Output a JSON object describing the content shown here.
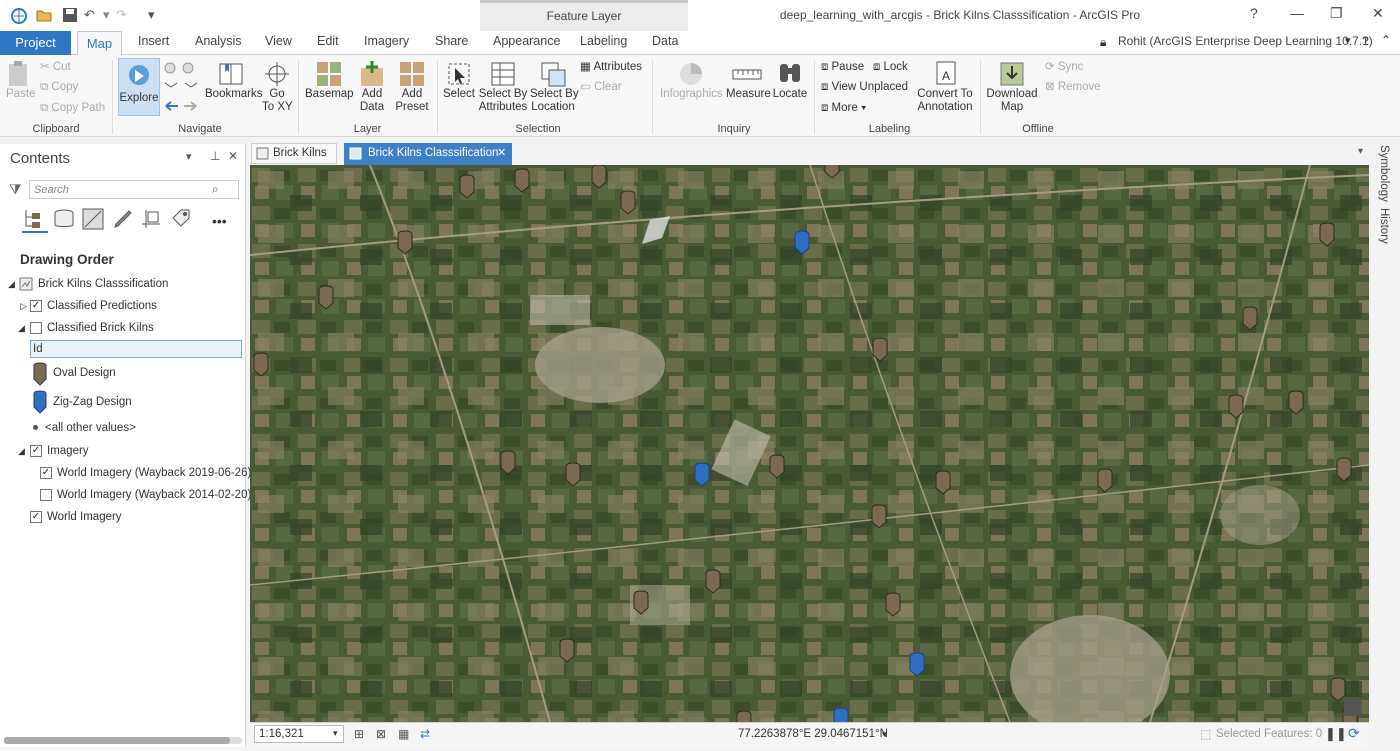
{
  "window": {
    "title": "deep_learning_with_arcgis - Brick Kilns Classsification - ArcGIS Pro",
    "context_tab": "Feature Layer"
  },
  "tabs": [
    "Project",
    "Map",
    "Insert",
    "Analysis",
    "View",
    "Edit",
    "Imagery",
    "Share",
    "Appearance",
    "Labeling",
    "Data"
  ],
  "user": "Rohit (ArcGIS Enterprise Deep Learning 10.7.1)",
  "clipboard": {
    "paste": "Paste",
    "cut": "Cut",
    "copy": "Copy",
    "copy_path": "Copy Path",
    "group": "Clipboard"
  },
  "navigate": {
    "explore": "Explore",
    "bookmarks": "Bookmarks",
    "go_to_xy": "Go\nTo XY",
    "group": "Navigate"
  },
  "layer": {
    "basemap": "Basemap",
    "add_data": "Add\nData",
    "add_preset": "Add\nPreset",
    "group": "Layer"
  },
  "selection": {
    "select": "Select",
    "select_by_attributes": "Select By\nAttributes",
    "select_by_location": "Select By\nLocation",
    "attributes": "Attributes",
    "clear": "Clear",
    "group": "Selection"
  },
  "inquiry": {
    "infographics": "Infographics",
    "measure": "Measure",
    "locate": "Locate",
    "group": "Inquiry"
  },
  "labeling": {
    "pause": "Pause",
    "lock": "Lock",
    "view_unplaced": "View Unplaced",
    "more": "More",
    "convert_to_annotation": "Convert To\nAnnotation",
    "group": "Labeling"
  },
  "offline": {
    "download_map": "Download\nMap",
    "sync": "Sync",
    "remove": "Remove",
    "group": "Offline"
  },
  "contents": {
    "title": "Contents",
    "search_placeholder": "Search",
    "section": "Drawing Order",
    "map": "Brick Kilns Classsification",
    "layers": [
      {
        "label": "Classified Predictions",
        "checked": true
      },
      {
        "label": "Classified Brick Kilns",
        "checked": false
      },
      {
        "label": "Id"
      },
      {
        "label": "Oval Design"
      },
      {
        "label": "Zig-Zag Design"
      },
      {
        "label": "<all other values>"
      },
      {
        "label": "Imagery",
        "checked": true
      },
      {
        "label": "World Imagery (Wayback 2019-06-26)",
        "checked": true
      },
      {
        "label": "World Imagery (Wayback 2014-02-20)",
        "checked": false
      },
      {
        "label": "World Imagery",
        "checked": true
      }
    ]
  },
  "map_tabs": [
    "Brick Kilns",
    "Brick Kilns Classsification"
  ],
  "right_panes": [
    "Symbology",
    "History"
  ],
  "status": {
    "scale": "1:16,321",
    "coords": "77.2263878°E 29.0467151°N",
    "selected": "Selected Features: 0"
  },
  "colors": {
    "oval": "#7a6a52",
    "zigzag": "#2e6fc4",
    "accent": "#2f77c5"
  }
}
